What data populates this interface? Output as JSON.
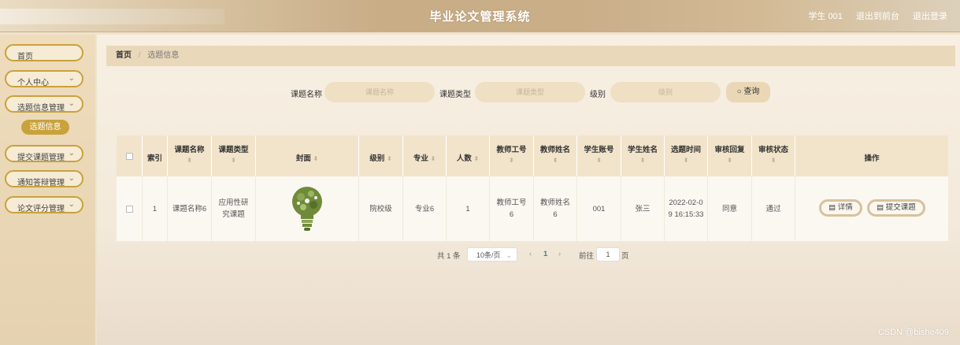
{
  "header": {
    "title": "毕业论文管理系统",
    "user": "学生 001",
    "back_to_front": "退出到前台",
    "logout": "退出登录"
  },
  "sidebar": {
    "items": [
      {
        "label": "首页"
      },
      {
        "label": "个人中心",
        "chevron": "⌄"
      },
      {
        "label": "选题信息管理",
        "chevron": "⌄"
      },
      {
        "label": "提交课题管理",
        "chevron": "⌄"
      },
      {
        "label": "通知答辩管理",
        "chevron": "⌄"
      },
      {
        "label": "论文评分管理",
        "chevron": "⌄"
      }
    ],
    "active_sub": "选题信息"
  },
  "breadcrumb": {
    "home": "首页",
    "sep": "/",
    "current": "选题信息"
  },
  "search": {
    "name_label": "课题名称",
    "name_placeholder": "课题名称",
    "type_label": "课题类型",
    "type_placeholder": "课题类型",
    "level_label": "级别",
    "level_placeholder": "级别",
    "button": "查询"
  },
  "table": {
    "headers": [
      "索引",
      "课题名称",
      "课题类型",
      "封面",
      "级别",
      "专业",
      "人数",
      "教师工号",
      "教师姓名",
      "学生账号",
      "学生姓名",
      "选题时间",
      "审核回复",
      "审核状态",
      "操作"
    ],
    "sort_glyph": "⬍",
    "rows": [
      {
        "index": "1",
        "name": "课题名称6",
        "type": "应用性研究课题",
        "level": "院校级",
        "major": "专业6",
        "count": "1",
        "teacher_id": "教师工号6",
        "teacher_name": "教师姓名6",
        "student_account": "001",
        "student_name": "张三",
        "time": "2022-02-09 16:15:33",
        "reply": "同意",
        "status": "通过",
        "detail": "详情",
        "submit": "提交课题"
      }
    ]
  },
  "pagination": {
    "total": "共 1 条",
    "page_size": "10条/页",
    "prev": "‹",
    "current": "1",
    "next": "›",
    "goto_label": "前往",
    "goto_value": "1",
    "goto_unit": "页"
  },
  "watermark": "CSDN @bishe409",
  "colors": {
    "accent": "#c9a23c",
    "header_bg": "#c8ad86",
    "table_head": "#f2e4cb"
  }
}
